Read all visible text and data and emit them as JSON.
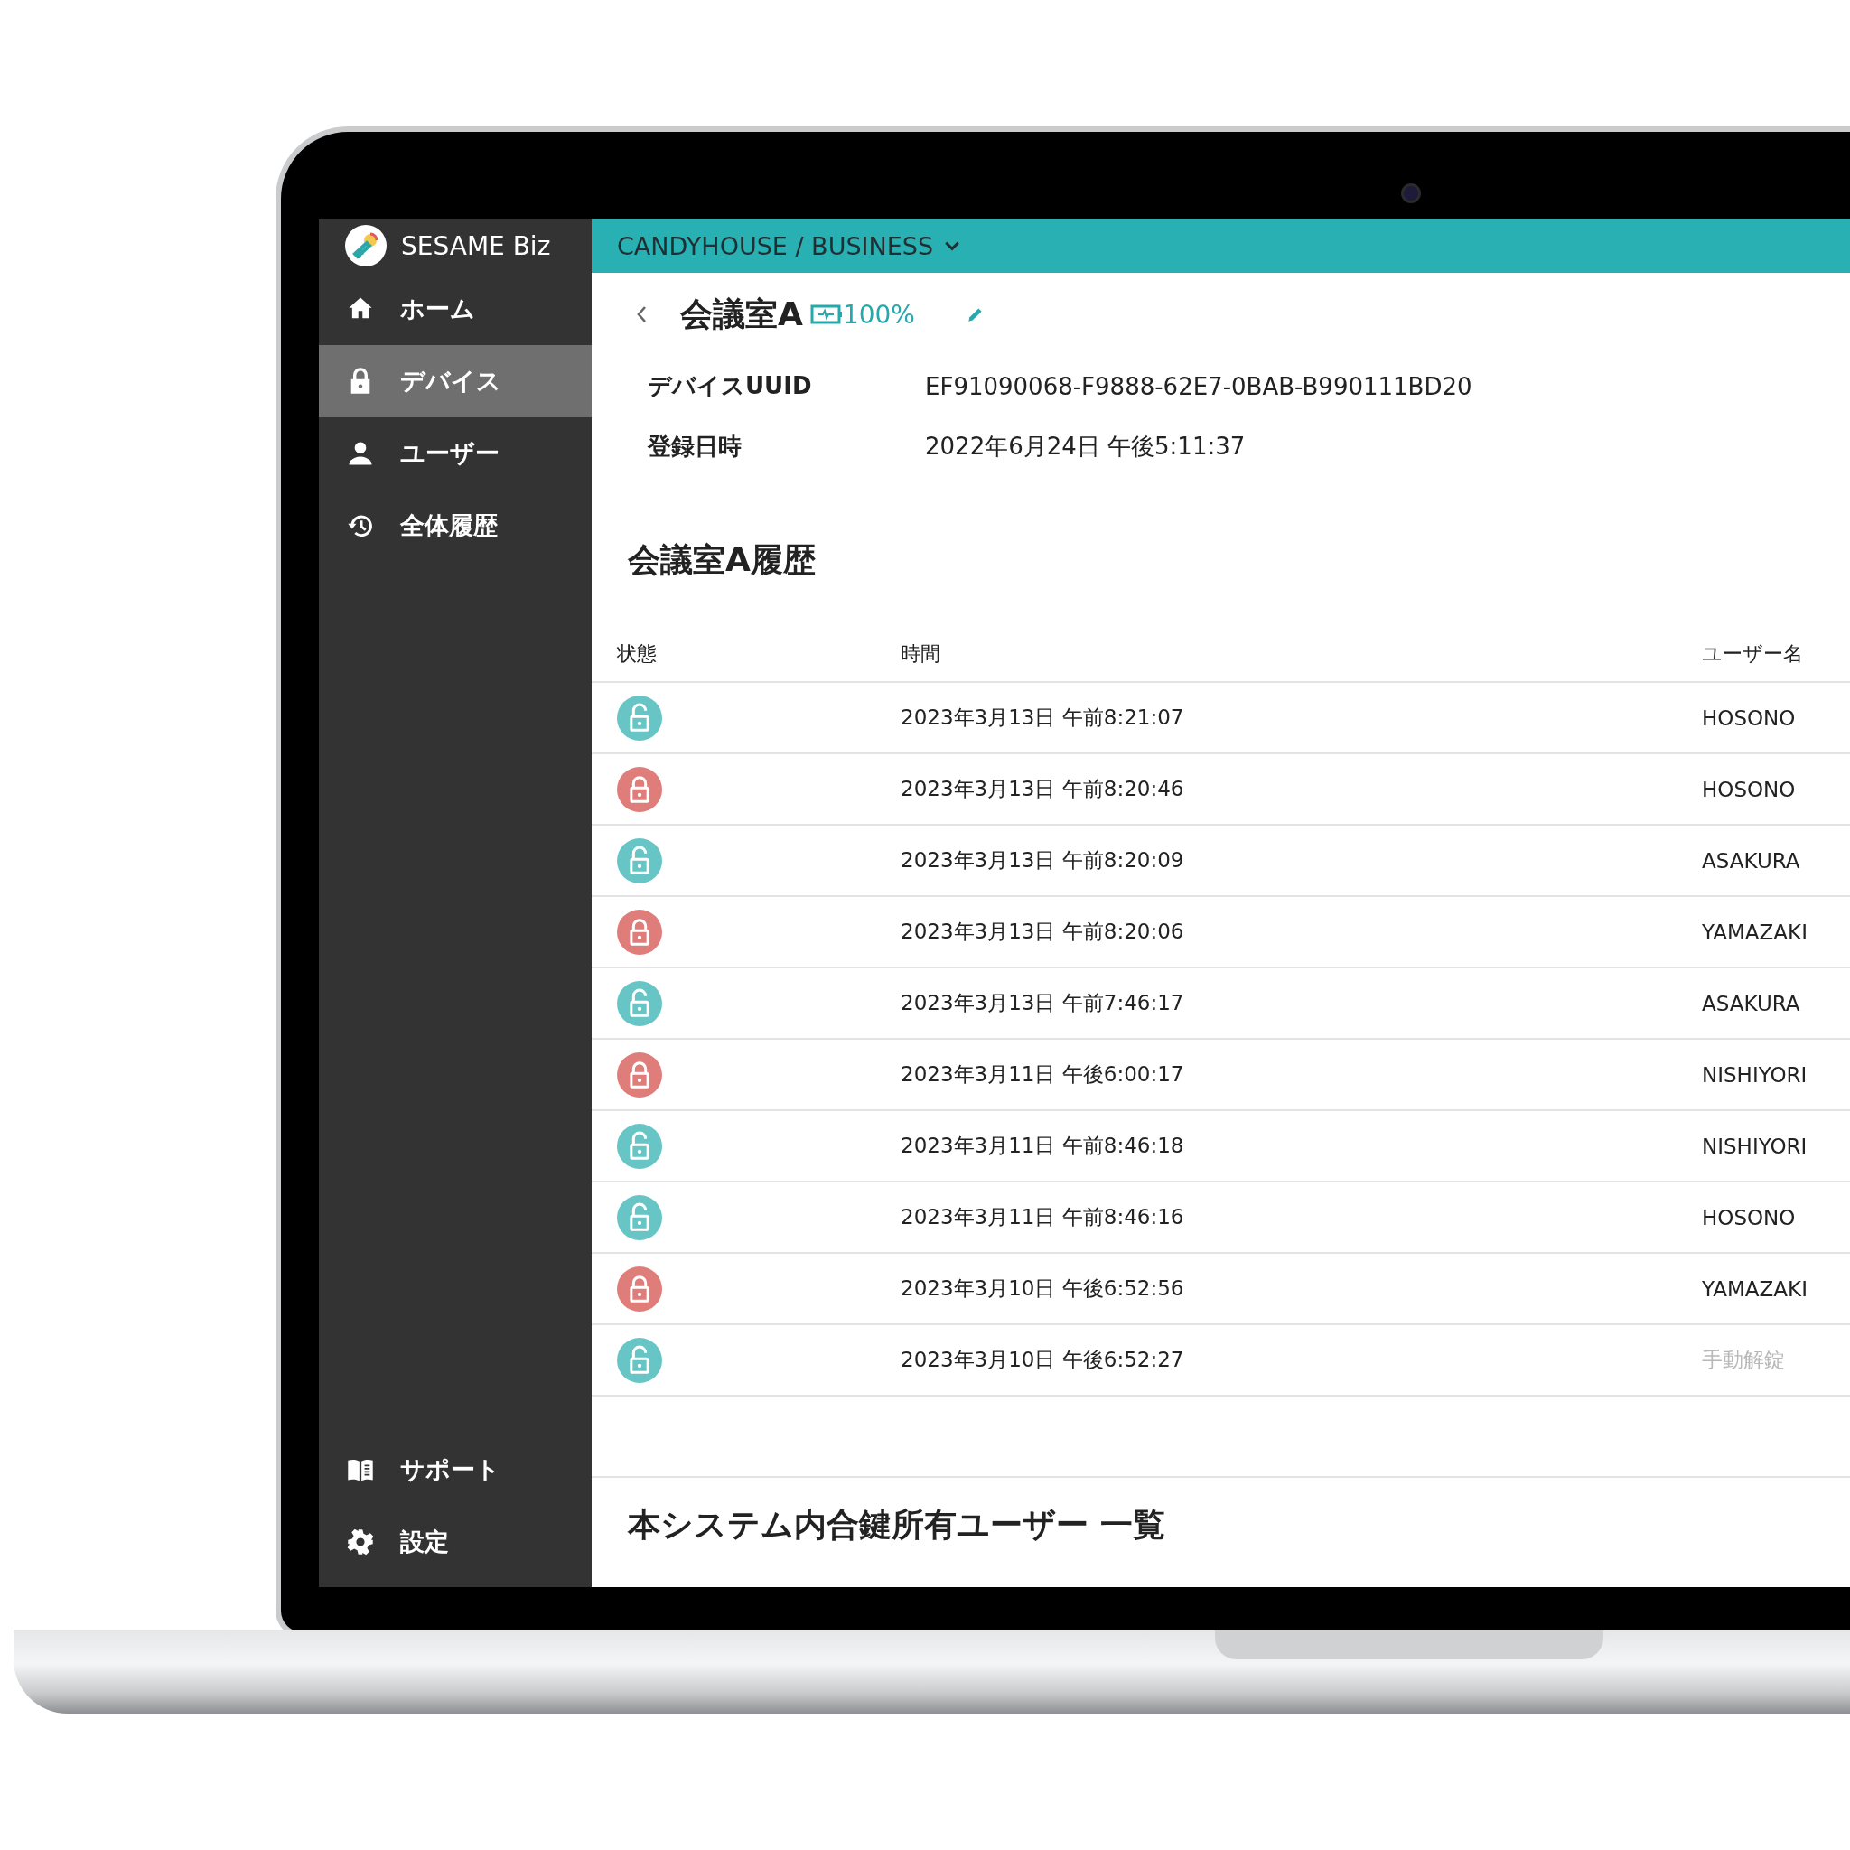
{
  "app": {
    "name": "SESAME Biz"
  },
  "sidebar": {
    "items": [
      {
        "label": "ホーム",
        "selected": false
      },
      {
        "label": "デバイス",
        "selected": true
      },
      {
        "label": "ユーザー",
        "selected": false
      },
      {
        "label": "全体履歴",
        "selected": false
      }
    ],
    "footer_items": [
      {
        "label": "サポート"
      },
      {
        "label": "設定"
      }
    ]
  },
  "header": {
    "organization": "CANDYHOUSE / BUSINESS"
  },
  "device": {
    "name": "会議室A",
    "battery": "100%",
    "fields": [
      {
        "label": "デバイスUUID",
        "value": "EF91090068-F9888-62E7-0BAB-B990111BD20"
      },
      {
        "label": "登録日時",
        "value": "2022年6月24日 午後5:11:37"
      }
    ]
  },
  "history": {
    "title": "会議室A履歴",
    "columns": [
      "状態",
      "時間",
      "ユーザー名"
    ],
    "rows": [
      {
        "locked": false,
        "time": "2023年3月13日 午前8:21:07",
        "user": "HOSONO",
        "user_muted": false
      },
      {
        "locked": true,
        "time": "2023年3月13日 午前8:20:46",
        "user": "HOSONO",
        "user_muted": false
      },
      {
        "locked": false,
        "time": "2023年3月13日 午前8:20:09",
        "user": "ASAKURA",
        "user_muted": false
      },
      {
        "locked": true,
        "time": "2023年3月13日 午前8:20:06",
        "user": "YAMAZAKI",
        "user_muted": false
      },
      {
        "locked": false,
        "time": "2023年3月13日 午前7:46:17",
        "user": "ASAKURA",
        "user_muted": false
      },
      {
        "locked": true,
        "time": "2023年3月11日 午後6:00:17",
        "user": "NISHIYORI",
        "user_muted": false
      },
      {
        "locked": false,
        "time": "2023年3月11日 午前8:46:18",
        "user": "NISHIYORI",
        "user_muted": false
      },
      {
        "locked": false,
        "time": "2023年3月11日 午前8:46:16",
        "user": "HOSONO",
        "user_muted": false
      },
      {
        "locked": true,
        "time": "2023年3月10日 午後6:52:56",
        "user": "YAMAZAKI",
        "user_muted": false
      },
      {
        "locked": false,
        "time": "2023年3月10日 午後6:52:27",
        "user": "手動解錠",
        "user_muted": true
      }
    ]
  },
  "key_owners": {
    "title": "本システム内合鍵所有ユーザー 一覧"
  }
}
